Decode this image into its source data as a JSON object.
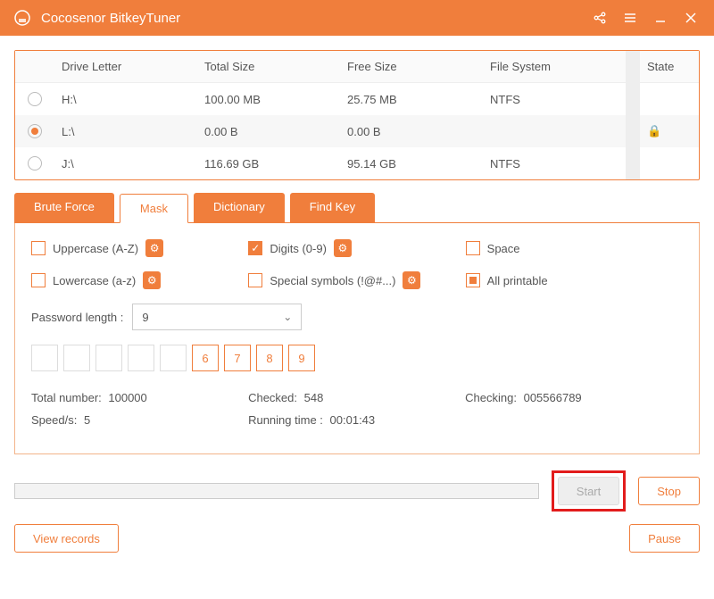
{
  "titlebar": {
    "title": "Cocosenor BitkeyTuner"
  },
  "drive_table": {
    "headers": {
      "letter": "Drive Letter",
      "total": "Total Size",
      "free": "Free Size",
      "fs": "File System",
      "state": "State"
    },
    "rows": [
      {
        "letter": "H:\\",
        "total": "100.00 MB",
        "free": "25.75 MB",
        "fs": "NTFS",
        "locked": false,
        "selected": false
      },
      {
        "letter": "L:\\",
        "total": "0.00 B",
        "free": "0.00 B",
        "fs": "",
        "locked": true,
        "selected": true
      },
      {
        "letter": "J:\\",
        "total": "116.69 GB",
        "free": "95.14 GB",
        "fs": "NTFS",
        "locked": false,
        "selected": false
      }
    ]
  },
  "tabs": {
    "items": [
      {
        "label": "Brute Force",
        "active": false
      },
      {
        "label": "Mask",
        "active": true
      },
      {
        "label": "Dictionary",
        "active": false
      },
      {
        "label": "Find Key",
        "active": false
      }
    ]
  },
  "options": {
    "uppercase": {
      "label": "Uppercase (A-Z)",
      "checked": false,
      "gear": true
    },
    "digits": {
      "label": "Digits (0-9)",
      "checked": true,
      "gear": true
    },
    "space": {
      "label": "Space",
      "checked": false,
      "gear": false
    },
    "lowercase": {
      "label": "Lowercase (a-z)",
      "checked": false,
      "gear": true
    },
    "special": {
      "label": "Special symbols (!@#...)",
      "checked": false,
      "gear": true
    },
    "allprint": {
      "label": "All printable",
      "indeterminate": true,
      "gear": false
    }
  },
  "password_length": {
    "label": "Password length :",
    "value": "9"
  },
  "mask_boxes": [
    "",
    "",
    "",
    "",
    "",
    "6",
    "7",
    "8",
    "9"
  ],
  "stats": {
    "total": {
      "label": "Total number:",
      "value": "100000"
    },
    "checked": {
      "label": "Checked:",
      "value": "548"
    },
    "checking": {
      "label": "Checking:",
      "value": "005566789"
    },
    "speed": {
      "label": "Speed/s:",
      "value": "5"
    },
    "runtime": {
      "label": "Running time :",
      "value": "00:01:43"
    }
  },
  "buttons": {
    "start": "Start",
    "stop": "Stop",
    "view_records": "View records",
    "pause": "Pause"
  }
}
